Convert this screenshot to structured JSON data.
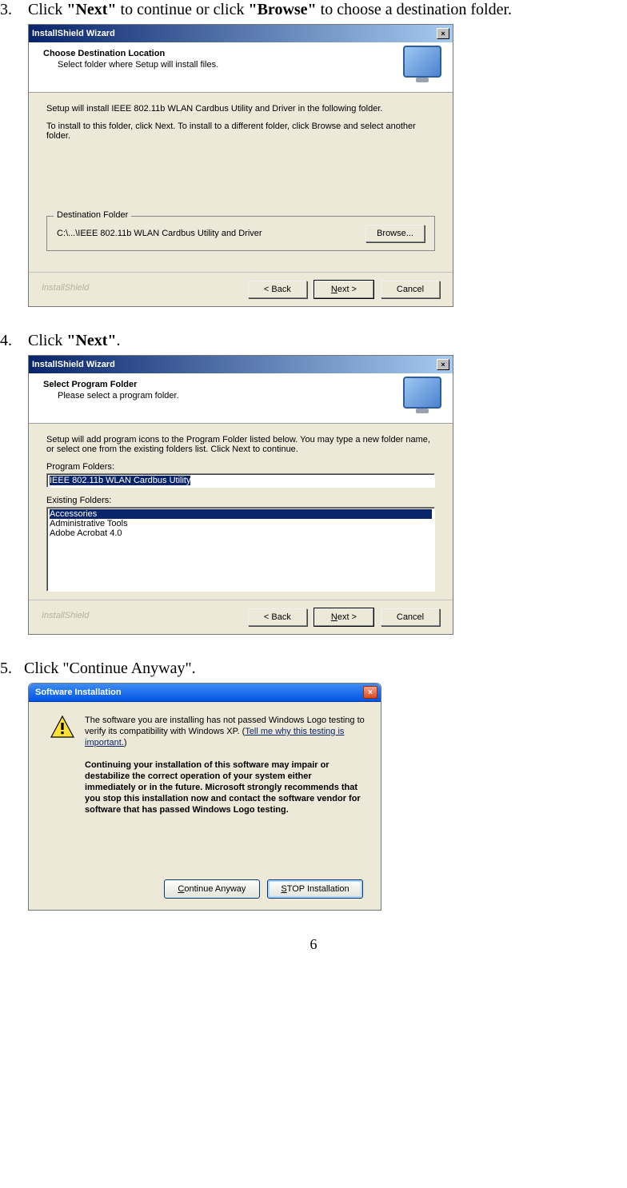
{
  "page_number": "6",
  "steps": [
    {
      "num": "3.",
      "prefix": "Click ",
      "bold1": "\"Next\"",
      "mid": " to continue or click ",
      "bold2": "\"Browse\"",
      "suffix": " to choose a destination folder."
    },
    {
      "num": "4.",
      "prefix": "Click ",
      "bold1": "\"Next\"",
      "suffix": "."
    },
    {
      "num": "5.",
      "prefix": "Click \"Continue Anyway\"."
    }
  ],
  "wizard1": {
    "title": "InstallShield Wizard",
    "header_title": "Choose Destination Location",
    "header_sub": "Select folder where Setup will install files.",
    "line1": "Setup will install IEEE 802.11b WLAN Cardbus Utility and Driver in the following folder.",
    "line2": "To install to this folder, click Next. To install to a different folder, click Browse and select another folder.",
    "fieldset_legend": "Destination Folder",
    "dest_path": "C:\\...\\IEEE 802.11b WLAN Cardbus Utility and Driver",
    "browse_btn": "Browse...",
    "brand": "InstallShield",
    "back_btn": "< Back",
    "next_btn_u": "N",
    "next_btn_rest": "ext >",
    "cancel_btn": "Cancel"
  },
  "wizard2": {
    "title": "InstallShield Wizard",
    "header_title": "Select Program Folder",
    "header_sub": "Please select a program folder.",
    "line1": "Setup will add program icons to the Program Folder listed below.  You may type a new folder name, or select one from the existing folders list.  Click Next to continue.",
    "program_folders_label_u": "P",
    "program_folders_label_rest": "rogram Folders:",
    "program_folder_value": "IEEE 802.11b WLAN Cardbus Utility",
    "existing_folders_label": "Existing Folders:",
    "existing_folders": [
      "Accessories",
      "Administrative Tools",
      "Adobe Acrobat 4.0"
    ],
    "brand": "InstallShield",
    "back_btn": "< Back",
    "next_btn_u": "N",
    "next_btn_rest": "ext >",
    "cancel_btn": "Cancel"
  },
  "warn_dialog": {
    "title": "Software Installation",
    "para1_a": "The software you are installing has not passed Windows Logo testing to verify its compatibility with Windows XP. (",
    "link": "Tell me why this testing is important.",
    "para1_b": ")",
    "bold_para": "Continuing your installation of this software may impair or destabilize the correct operation of your system either immediately or in the future. Microsoft strongly recommends that you stop this installation now and contact the software vendor for software that has passed Windows Logo testing.",
    "continue_btn_u": "C",
    "continue_btn_rest": "ontinue Anyway",
    "stop_btn_u": "S",
    "stop_btn_rest": "TOP Installation"
  }
}
